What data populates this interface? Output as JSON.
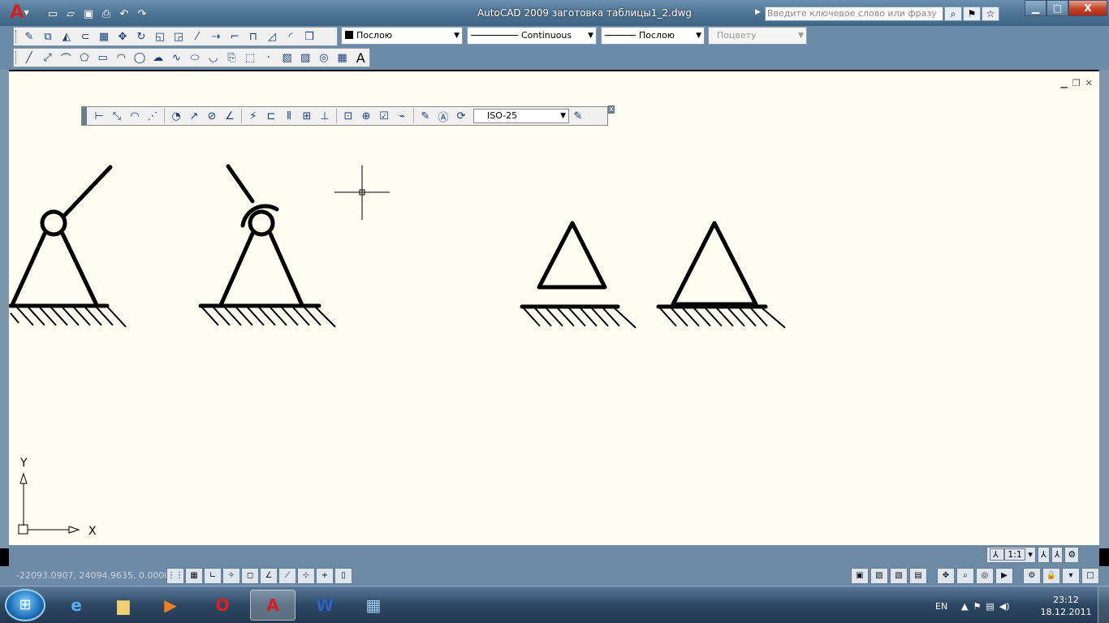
{
  "window": {
    "title": "AutoCAD 2009 заготовка таблицы1_2.dwg",
    "app_button_glyph": "A",
    "minimize": "▁",
    "maximize": "□",
    "close": "X"
  },
  "search": {
    "placeholder": "Введите ключевое слово или фразу"
  },
  "properties": {
    "layer_color": "Послою",
    "linetype": "Continuous",
    "lineweight": "Послою",
    "plot_style": "Поцвету"
  },
  "dim_toolbar": {
    "dimstyle": "ISO-25",
    "close": "x"
  },
  "draw_toolbar": {
    "text_tool": "A"
  },
  "ucs": {
    "x_label": "X",
    "y_label": "Y"
  },
  "status": {
    "coords": "-22093.0907, 24094.9635, 0.0000",
    "annotation_scale": "1:1"
  },
  "taskbar": {
    "language": "EN",
    "time": "23:12",
    "date": "18.12.2011"
  },
  "colors": {
    "titlebar": "#4d7393",
    "canvas_bg": "#fefdf2",
    "toolbar_bg": "#f0f0f0",
    "accent_red": "#d02020"
  },
  "icons": {
    "qat": [
      "new-icon",
      "open-icon",
      "save-icon",
      "print-icon",
      "undo-icon",
      "redo-icon"
    ],
    "modify": [
      "erase-icon",
      "copy-icon",
      "mirror-icon",
      "offset-icon",
      "array-icon",
      "move-icon",
      "rotate-icon",
      "scale-icon",
      "stretch-icon",
      "trim-icon",
      "extend-icon",
      "break-icon",
      "join-icon",
      "chamfer-icon",
      "fillet-icon",
      "explode-icon"
    ],
    "draw": [
      "line-icon",
      "xline-icon",
      "polyline-icon",
      "polygon-icon",
      "rectangle-icon",
      "arc-icon",
      "circle-icon",
      "revcloud-icon",
      "spline-icon",
      "ellipse-icon",
      "ellipse-arc-icon",
      "insert-block-icon",
      "make-block-icon",
      "point-icon",
      "hatch-icon",
      "gradient-icon",
      "region-icon",
      "table-icon"
    ]
  }
}
